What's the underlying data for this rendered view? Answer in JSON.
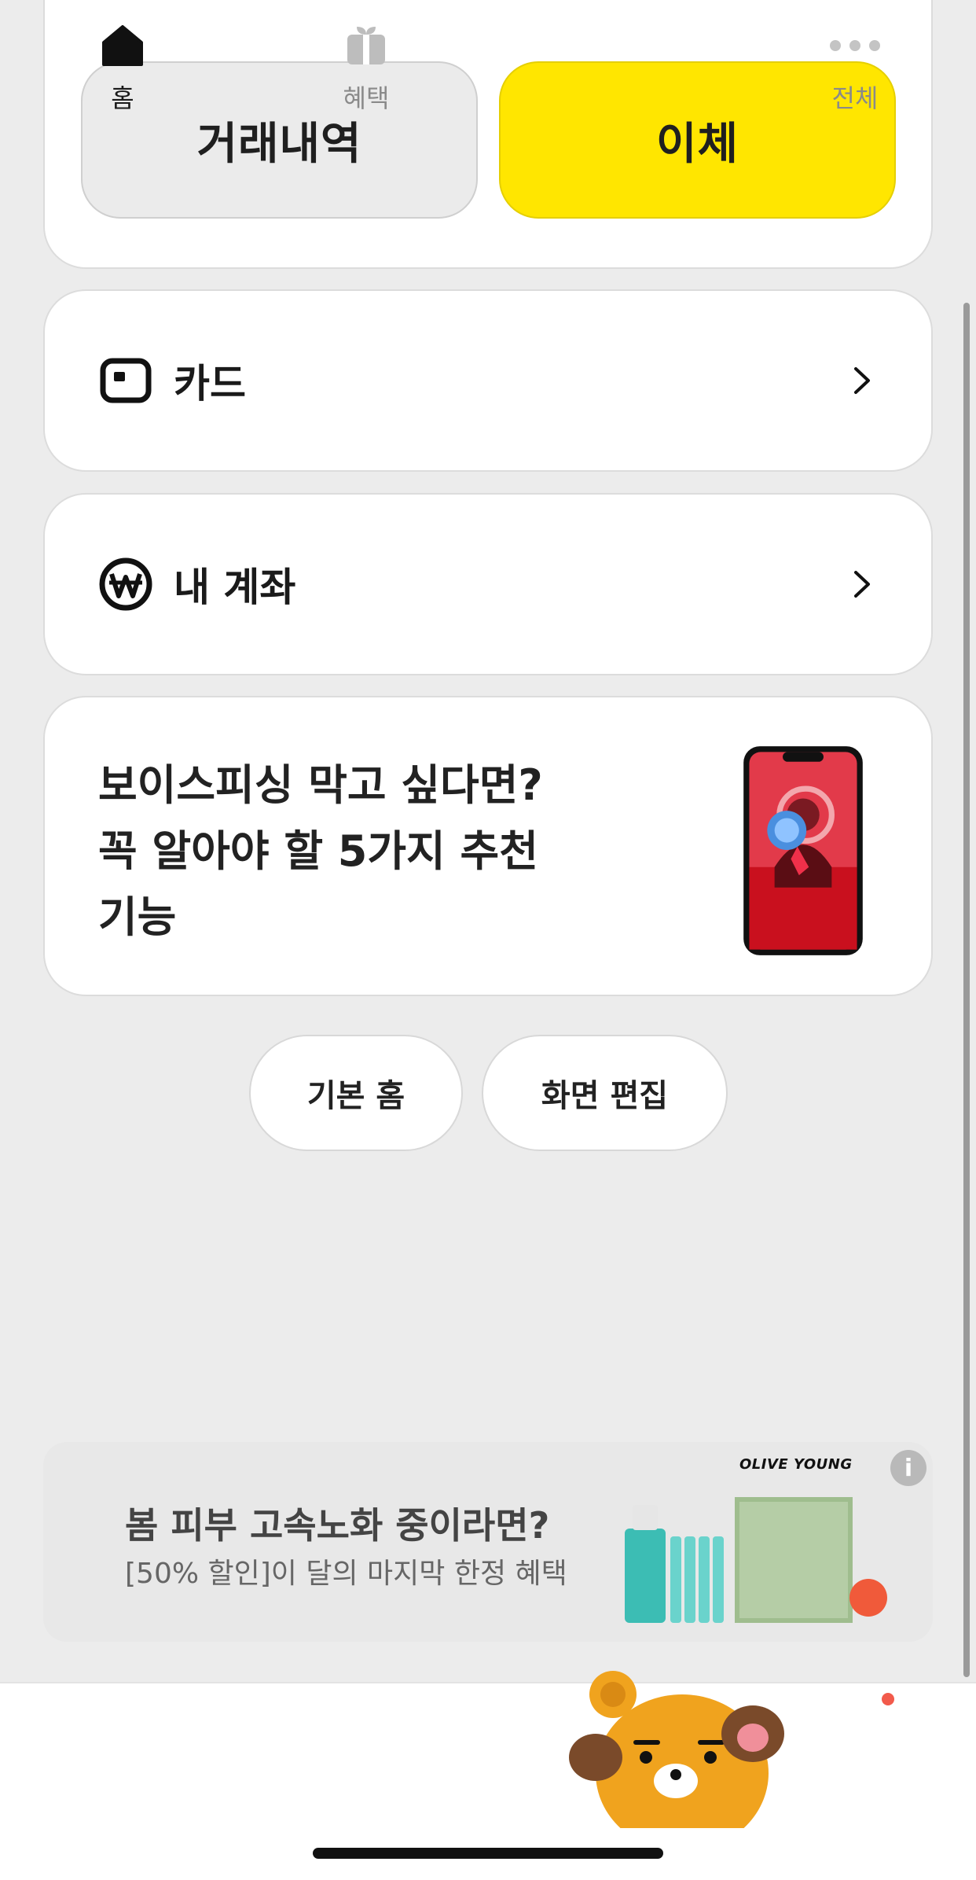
{
  "top_actions": {
    "history_label": "거래내역",
    "transfer_label": "이체"
  },
  "menu": {
    "card_label": "카드",
    "account_label": "내 계좌"
  },
  "promo": {
    "line1": "보이스피싱 막고 싶다면?",
    "line2": "꼭 알아야 할 5가지 추천",
    "line3": "기능"
  },
  "home_buttons": {
    "default_home": "기본 홈",
    "edit_screen": "화면 편집"
  },
  "ad": {
    "brand": "OLIVE YOUNG",
    "title": "봄 피부 고속노화 중이라면?",
    "subtitle": "[50% 할인]이 달의 마지막 한정 혜택",
    "info": "i"
  },
  "tabs": {
    "home": "홈",
    "benefit": "혜택",
    "all": "전체"
  },
  "colors": {
    "accent_yellow": "#ffe600",
    "background": "#ececec",
    "notification_dot": "#f25a4b"
  }
}
